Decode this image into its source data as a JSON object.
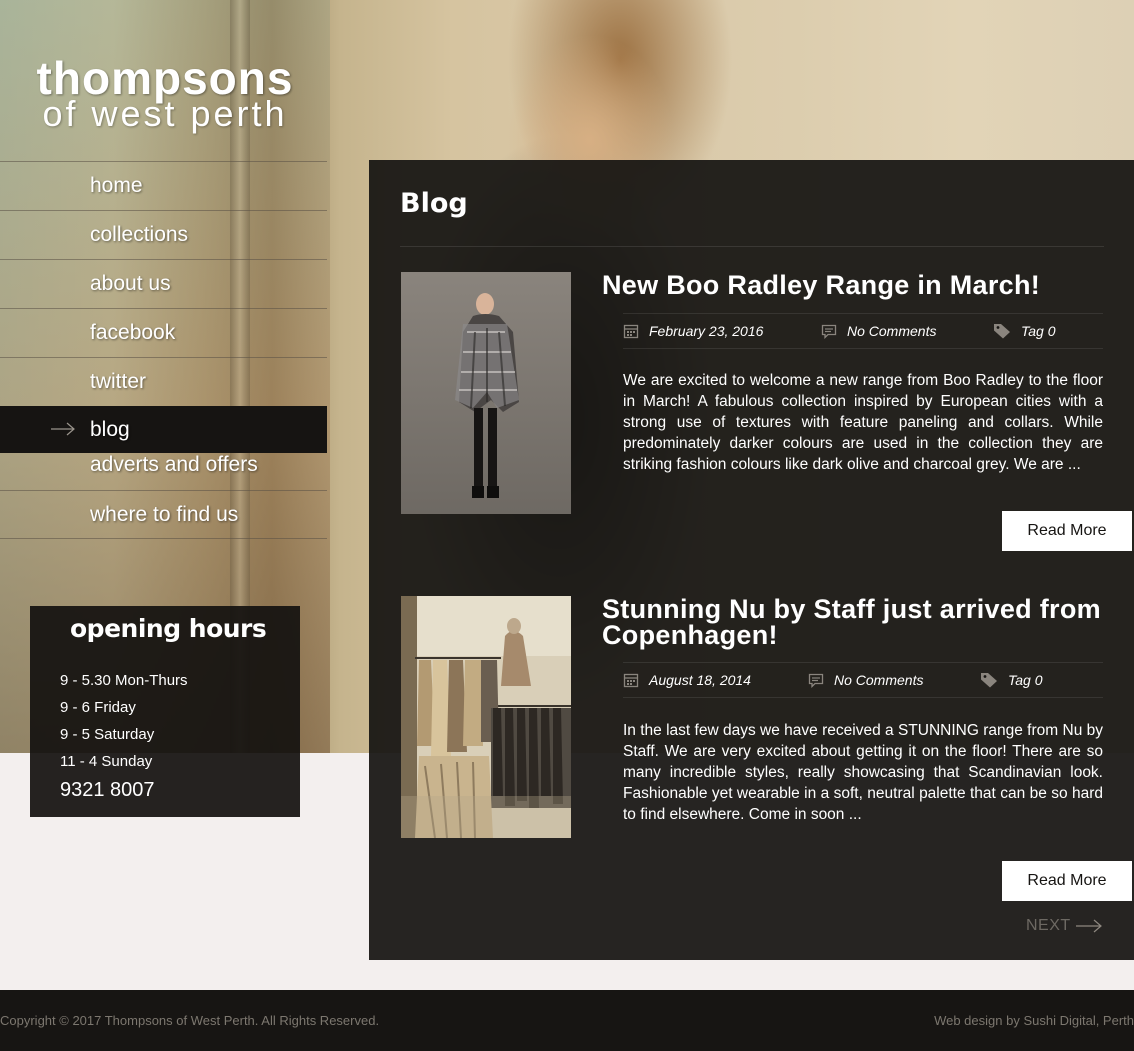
{
  "logo": {
    "main": "thompsons",
    "sub": "of west perth"
  },
  "nav": {
    "items": [
      {
        "label": "home"
      },
      {
        "label": "collections"
      },
      {
        "label": "about us"
      },
      {
        "label": "facebook"
      },
      {
        "label": "twitter"
      },
      {
        "label": "blog",
        "active": true
      },
      {
        "label": "adverts and offers"
      },
      {
        "label": "where to find us"
      }
    ]
  },
  "hours": {
    "title": "opening hours",
    "lines": [
      "9 - 5.30 Mon-Thurs",
      "9 - 6 Friday",
      "9 - 5 Saturday",
      "11 - 4 Sunday"
    ],
    "phone": "9321 8007"
  },
  "blog": {
    "title": "Blog",
    "posts": [
      {
        "title": "New Boo Radley Range in March!",
        "date": "February 23, 2016",
        "comments": "No Comments",
        "tag": "Tag 0",
        "excerpt": "We are excited to welcome a new range from Boo Radley to the floor in March! A fabulous collection inspired by European cities with a strong use of textures with feature paneling and collars. While predominately darker colours are used in the collection they are striking fashion colours like dark olive and charcoal grey. We are ...",
        "read_more": "Read More"
      },
      {
        "title": "Stunning Nu by Staff just arrived from Copenhagen!",
        "date": "August 18, 2014",
        "comments": "No Comments",
        "tag": "Tag 0",
        "excerpt": "In the last few days we have received a STUNNING range from Nu by Staff. We are very excited about getting it on the floor! There are so many incredible styles, really showcasing that Scandinavian look. Fashionable yet wearable in a soft, neutral palette that can be so hard to find elsewhere. Come in soon ...",
        "read_more": "Read More"
      }
    ],
    "next": "NEXT"
  },
  "footer": {
    "copyright": "Copyright © 2017 Thompsons of West Perth. All Rights Reserved.",
    "credit": "Web design by Sushi Digital, Perth"
  },
  "colors": {
    "panel_bg": "#161412",
    "page_bg": "#f3efee",
    "button_bg": "#ffffff",
    "muted_link": "#6d6963"
  }
}
